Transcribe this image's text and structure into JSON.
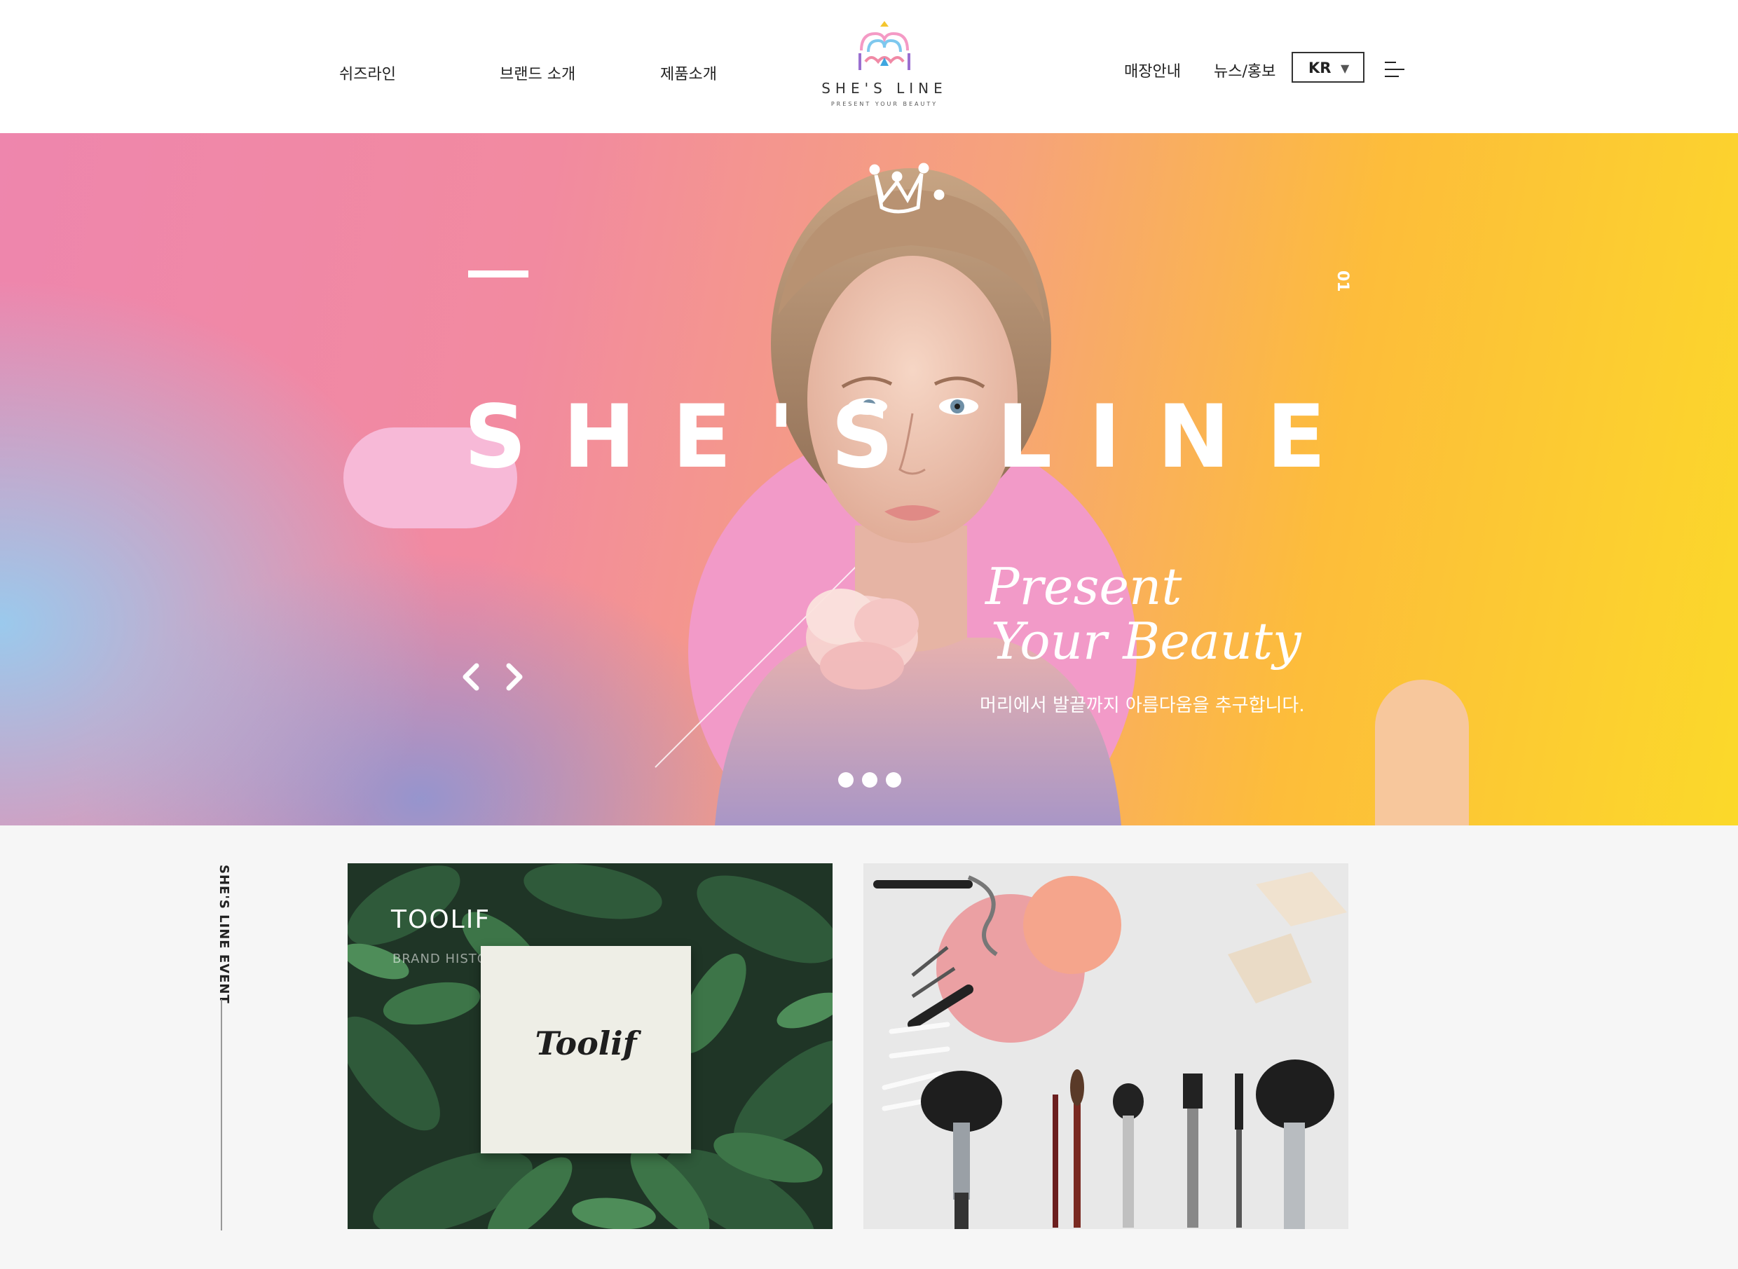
{
  "nav": {
    "left": [
      "쉬즈라인",
      "브랜드 소개",
      "제품소개"
    ],
    "right": [
      "매장안내",
      "뉴스/홍보"
    ]
  },
  "logo": {
    "wordmark": "SHE'S LINE",
    "tagline": "PRESENT YOUR BEAUTY"
  },
  "language": {
    "selected": "KR"
  },
  "hero": {
    "title": "SHE'S LINE",
    "slide_number": "01",
    "script_line1": "Present",
    "script_line2": "Your Beauty",
    "description": "머리에서 발끝까지 아름다움을 추구합니다.",
    "slide_count": 3,
    "active_slide": 1
  },
  "event": {
    "section_label": "SHE'S LINE EVENT",
    "cards": [
      {
        "title": "TOOLIF",
        "subtitle": "BRAND HISTORY",
        "product_name": "Toolif"
      },
      {
        "image": "makeup-tools-photo"
      }
    ]
  },
  "colors": {
    "hero_pink": "#ee86ad",
    "hero_yellow": "#fbd92a",
    "hero_blue": "#96cdf0",
    "accent_pink": "#f29ac8"
  },
  "icons": [
    "menu-icon",
    "chevron-left-icon",
    "chevron-right-icon",
    "crown-icon",
    "dropdown-caret-icon"
  ]
}
